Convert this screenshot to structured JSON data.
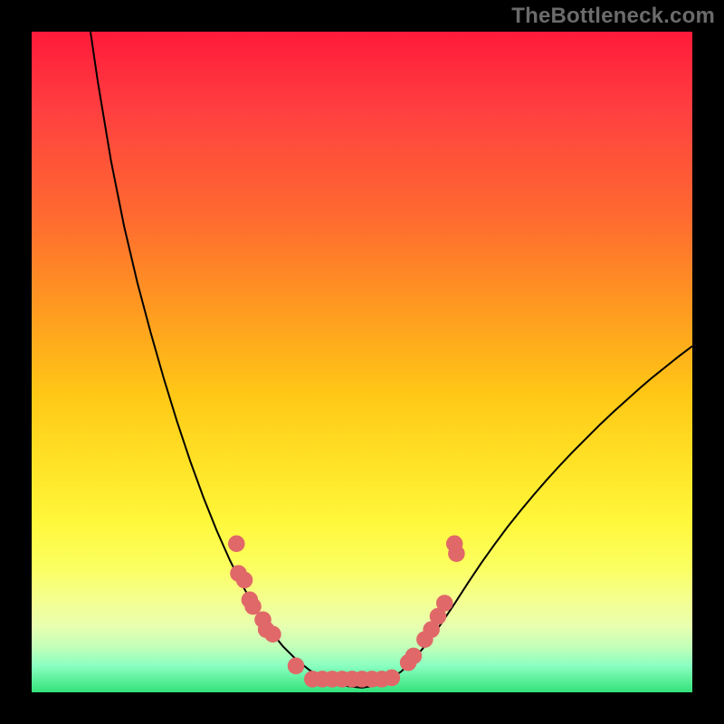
{
  "watermark": "TheBottleneck.com",
  "chart_data": {
    "type": "line",
    "title": "",
    "xlabel": "",
    "ylabel": "",
    "xlim": [
      0,
      100
    ],
    "ylim": [
      0,
      100
    ],
    "curve": {
      "name": "bottleneck-curve",
      "color": "#000000",
      "points": [
        {
          "x": 8.9,
          "y": 100.0
        },
        {
          "x": 10.0,
          "y": 92.5
        },
        {
          "x": 12.0,
          "y": 80.5
        },
        {
          "x": 14.0,
          "y": 70.5
        },
        {
          "x": 16.0,
          "y": 62.0
        },
        {
          "x": 18.0,
          "y": 54.5
        },
        {
          "x": 20.0,
          "y": 47.5
        },
        {
          "x": 22.0,
          "y": 41.0
        },
        {
          "x": 24.0,
          "y": 35.0
        },
        {
          "x": 26.0,
          "y": 29.5
        },
        {
          "x": 28.0,
          "y": 24.5
        },
        {
          "x": 30.0,
          "y": 20.0
        },
        {
          "x": 32.0,
          "y": 16.0
        },
        {
          "x": 34.0,
          "y": 12.5
        },
        {
          "x": 36.0,
          "y": 9.5
        },
        {
          "x": 38.0,
          "y": 7.0
        },
        {
          "x": 40.0,
          "y": 5.0
        },
        {
          "x": 42.0,
          "y": 3.4
        },
        {
          "x": 44.0,
          "y": 2.2
        },
        {
          "x": 46.0,
          "y": 1.4
        },
        {
          "x": 48.0,
          "y": 0.9
        },
        {
          "x": 50.0,
          "y": 0.7
        },
        {
          "x": 52.0,
          "y": 1.0
        },
        {
          "x": 54.0,
          "y": 1.8
        },
        {
          "x": 56.0,
          "y": 3.2
        },
        {
          "x": 58.0,
          "y": 5.2
        },
        {
          "x": 60.0,
          "y": 7.6
        },
        {
          "x": 62.0,
          "y": 10.4
        },
        {
          "x": 64.0,
          "y": 13.4
        },
        {
          "x": 66.0,
          "y": 16.5
        },
        {
          "x": 68.0,
          "y": 19.5
        },
        {
          "x": 70.0,
          "y": 22.3
        },
        {
          "x": 72.0,
          "y": 25.0
        },
        {
          "x": 74.0,
          "y": 27.5
        },
        {
          "x": 76.0,
          "y": 29.9
        },
        {
          "x": 78.0,
          "y": 32.2
        },
        {
          "x": 80.0,
          "y": 34.4
        },
        {
          "x": 82.0,
          "y": 36.5
        },
        {
          "x": 84.0,
          "y": 38.5
        },
        {
          "x": 86.0,
          "y": 40.5
        },
        {
          "x": 88.0,
          "y": 42.4
        },
        {
          "x": 90.0,
          "y": 44.2
        },
        {
          "x": 92.0,
          "y": 46.0
        },
        {
          "x": 94.0,
          "y": 47.7
        },
        {
          "x": 96.0,
          "y": 49.3
        },
        {
          "x": 98.0,
          "y": 50.9
        },
        {
          "x": 100.0,
          "y": 52.4
        }
      ]
    },
    "dots": {
      "name": "benchmark-points",
      "color": "#e06868",
      "radius_frac": 0.012,
      "points": [
        {
          "x": 31.0,
          "y": 22.5
        },
        {
          "x": 31.3,
          "y": 18.0
        },
        {
          "x": 32.2,
          "y": 17.0
        },
        {
          "x": 33.0,
          "y": 14.0
        },
        {
          "x": 33.5,
          "y": 13.0
        },
        {
          "x": 35.0,
          "y": 11.0
        },
        {
          "x": 35.5,
          "y": 9.5
        },
        {
          "x": 36.5,
          "y": 8.8
        },
        {
          "x": 40.0,
          "y": 4.0
        },
        {
          "x": 42.5,
          "y": 2.0
        },
        {
          "x": 44.0,
          "y": 2.0
        },
        {
          "x": 45.5,
          "y": 2.0
        },
        {
          "x": 47.0,
          "y": 2.0
        },
        {
          "x": 48.5,
          "y": 2.0
        },
        {
          "x": 50.0,
          "y": 2.0
        },
        {
          "x": 51.5,
          "y": 2.0
        },
        {
          "x": 53.0,
          "y": 2.0
        },
        {
          "x": 54.5,
          "y": 2.2
        },
        {
          "x": 57.0,
          "y": 4.5
        },
        {
          "x": 57.8,
          "y": 5.5
        },
        {
          "x": 59.5,
          "y": 8.0
        },
        {
          "x": 60.5,
          "y": 9.5
        },
        {
          "x": 61.5,
          "y": 11.5
        },
        {
          "x": 62.5,
          "y": 13.5
        },
        {
          "x": 64.0,
          "y": 22.5
        },
        {
          "x": 64.3,
          "y": 21.0
        }
      ]
    }
  }
}
